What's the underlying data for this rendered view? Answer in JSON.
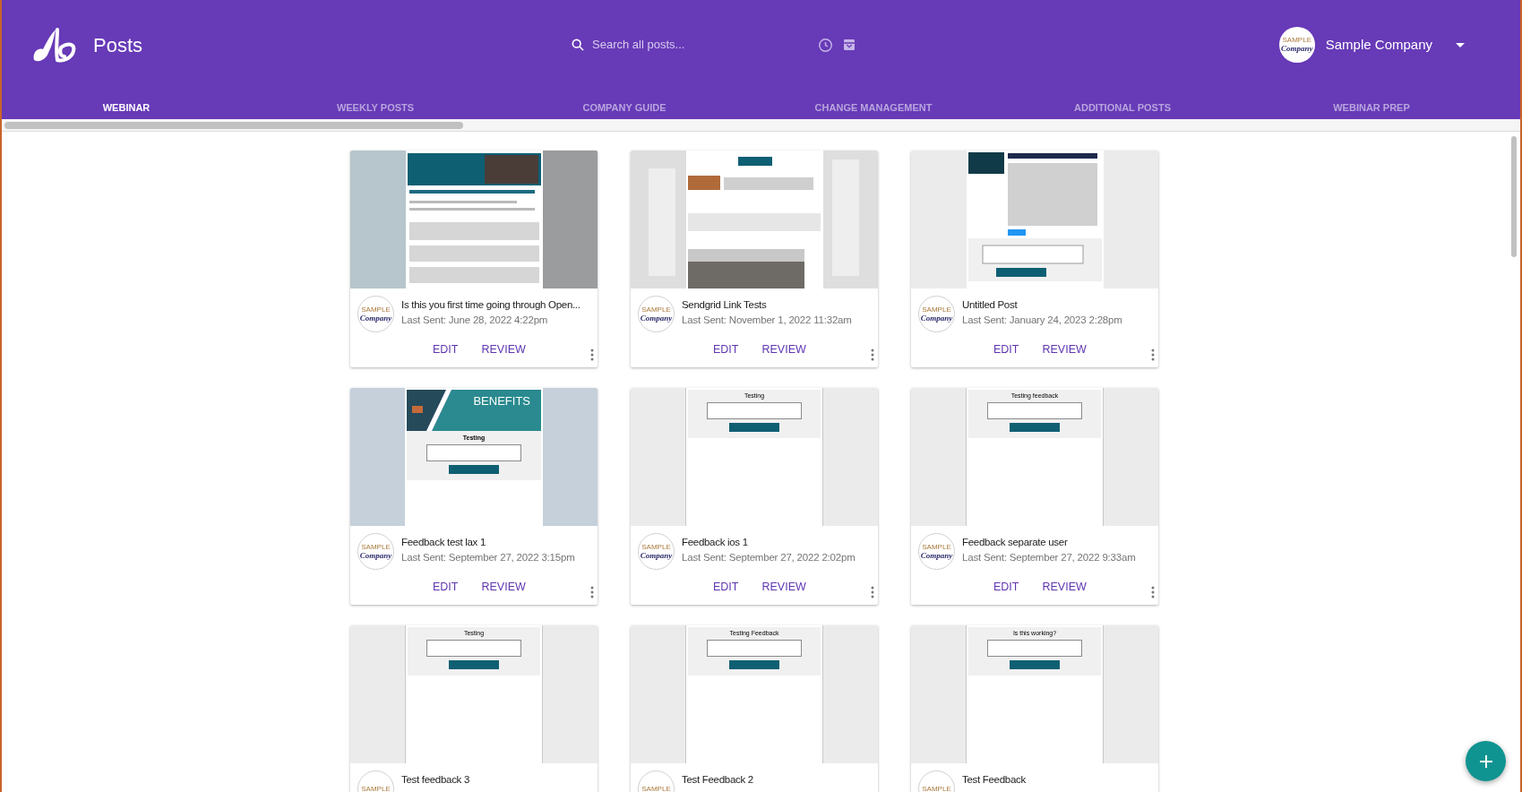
{
  "header": {
    "title": "Posts",
    "search": {
      "placeholder": "Search all posts..."
    },
    "account": {
      "name": "Sample Company",
      "avatar": {
        "top": "SAMPLE",
        "main": "Company"
      }
    }
  },
  "tabs": [
    {
      "label": "WEBINAR",
      "selected": true
    },
    {
      "label": "WEEKLY POSTS",
      "selected": false
    },
    {
      "label": "COMPANY GUIDE",
      "selected": false
    },
    {
      "label": "CHANGE MANAGEMENT",
      "selected": false
    },
    {
      "label": "ADDITIONAL POSTS",
      "selected": false
    },
    {
      "label": "WEBINAR PREP",
      "selected": false
    }
  ],
  "posts": [
    {
      "title": "Is this you first time going through Open...",
      "last_sent": "Last Sent: June 28, 2022 4:22pm",
      "avatar": {
        "top": "SAMPLE",
        "main": "Company"
      },
      "actions": [
        "EDIT",
        "REVIEW"
      ]
    },
    {
      "title": "Sendgrid Link Tests",
      "last_sent": "Last Sent: November 1, 2022 11:32am",
      "avatar": {
        "top": "SAMPLE",
        "main": "Company"
      },
      "actions": [
        "EDIT",
        "REVIEW"
      ]
    },
    {
      "title": "Untitled Post",
      "last_sent": "Last Sent: January 24, 2023 2:28pm",
      "avatar": {
        "top": "SAMPLE",
        "main": "Company"
      },
      "actions": [
        "EDIT",
        "REVIEW"
      ]
    },
    {
      "title": "Feedback test lax 1",
      "last_sent": "Last Sent: September 27, 2022 3:15pm",
      "thumbnail": {
        "kind": "banner_form",
        "banner_text": "BENEFITS",
        "heading": "Testing"
      },
      "avatar": {
        "top": "SAMPLE",
        "main": "Company"
      },
      "actions": [
        "EDIT",
        "REVIEW"
      ]
    },
    {
      "title": "Feedback ios 1",
      "last_sent": "Last Sent: September 27, 2022 2:02pm",
      "thumbnail": {
        "kind": "form",
        "heading": "Testing"
      },
      "avatar": {
        "top": "SAMPLE",
        "main": "Company"
      },
      "actions": [
        "EDIT",
        "REVIEW"
      ]
    },
    {
      "title": "Feedback separate user",
      "last_sent": "Last Sent: September 27, 2022 9:33am",
      "thumbnail": {
        "kind": "form",
        "heading": "Testing feedback"
      },
      "avatar": {
        "top": "SAMPLE",
        "main": "Company"
      },
      "actions": [
        "EDIT",
        "REVIEW"
      ]
    },
    {
      "title": "Test feedback 3",
      "thumbnail": {
        "kind": "form",
        "heading": "Testing"
      },
      "avatar": {
        "top": "SAMPLE"
      }
    },
    {
      "title": "Test Feedback 2",
      "thumbnail": {
        "kind": "form",
        "heading": "Testing Feedback"
      },
      "avatar": {
        "top": "SAMPLE"
      }
    },
    {
      "title": "Test Feedback",
      "thumbnail": {
        "kind": "form",
        "heading": "Is this working?"
      },
      "avatar": {
        "top": "SAMPLE"
      }
    }
  ]
}
